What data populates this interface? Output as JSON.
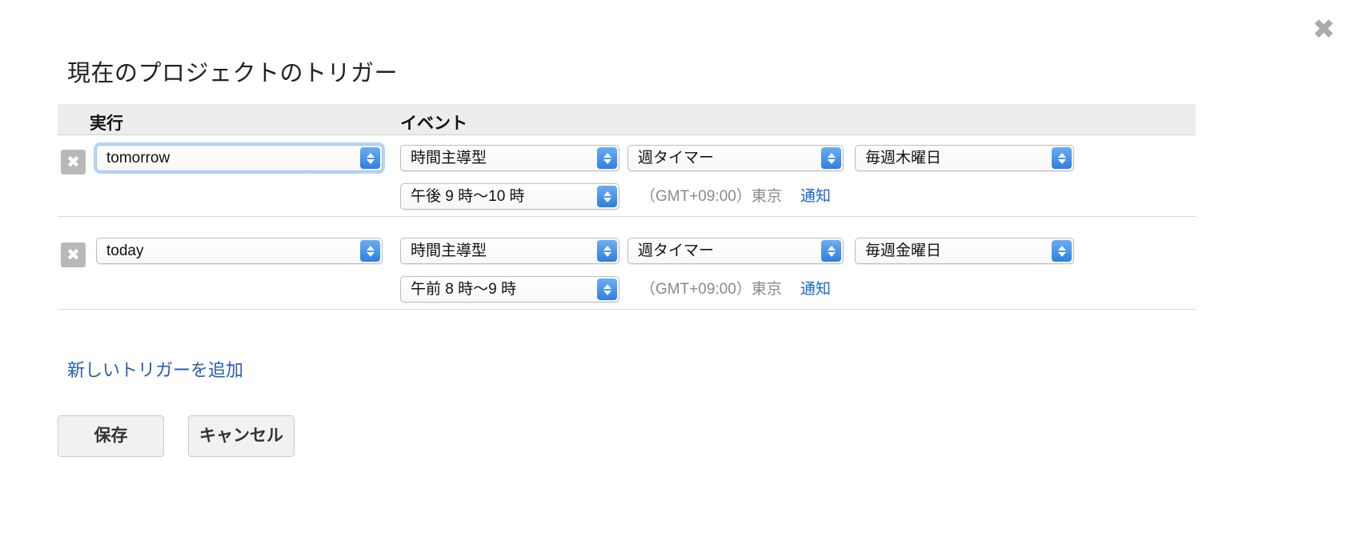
{
  "dialog": {
    "title": "現在のプロジェクトのトリガー",
    "close_icon": "close-icon",
    "close_label": "✖"
  },
  "table": {
    "headers": {
      "run": "実行",
      "event": "イベント"
    }
  },
  "triggers": [
    {
      "delete_label": "✖",
      "function_value": "tomorrow",
      "focused": true,
      "event_type": "時間主導型",
      "timer_type": "週タイマー",
      "day_value": "毎週木曜日",
      "time_value": "午後 9 時〜10 時",
      "timezone": "（GMT+09:00）東京",
      "notify_label": "通知"
    },
    {
      "delete_label": "✖",
      "function_value": "today",
      "focused": false,
      "event_type": "時間主導型",
      "timer_type": "週タイマー",
      "day_value": "毎週金曜日",
      "time_value": "午前 8 時〜9 時",
      "timezone": "（GMT+09:00）東京",
      "notify_label": "通知"
    }
  ],
  "footer": {
    "add_trigger": "新しいトリガーを追加",
    "save": "保存",
    "cancel": "キャンセル"
  },
  "colors": {
    "link": "#2a5db0",
    "notify_link": "#1967d2",
    "header_bg": "#ededed",
    "select_arrow": "#2f7fe0",
    "focus_ring": "#7ab1ed"
  }
}
